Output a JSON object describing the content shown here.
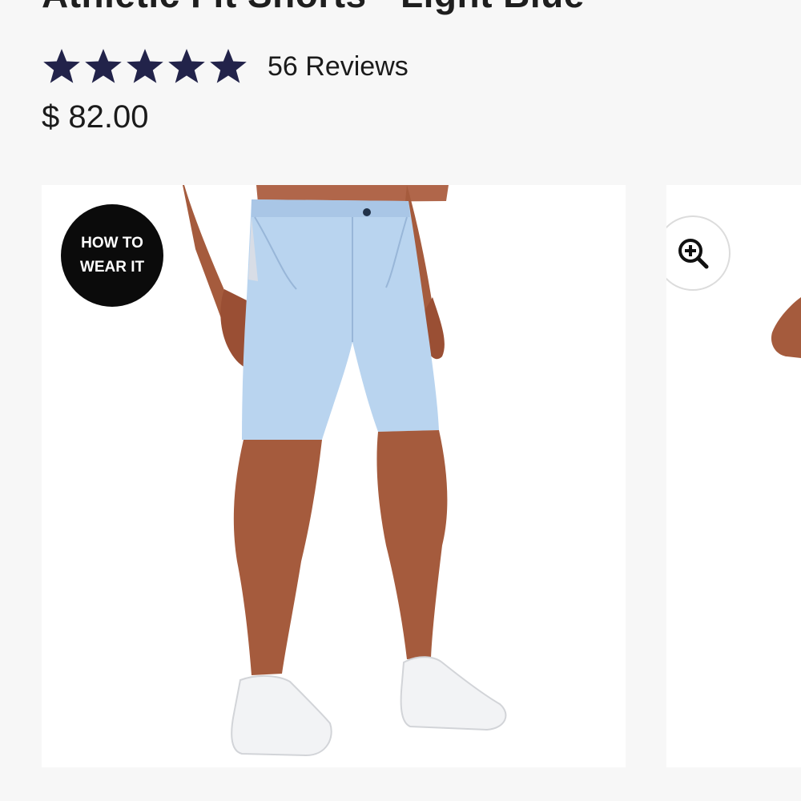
{
  "product": {
    "title": "Athletic Fit Shorts - Light Blue",
    "rating": 5,
    "reviews_label": "56 Reviews",
    "price": "$ 82.00"
  },
  "gallery": {
    "badge_line1": "HOW TO",
    "badge_line2": "WEAR IT",
    "zoom_icon": "zoom-in-icon",
    "image_alt": "Light blue athletic fit shorts worn with white sneakers"
  },
  "colors": {
    "star": "#22234a",
    "badge_bg": "#0b0b0b",
    "shorts": "#b9d4ef"
  }
}
